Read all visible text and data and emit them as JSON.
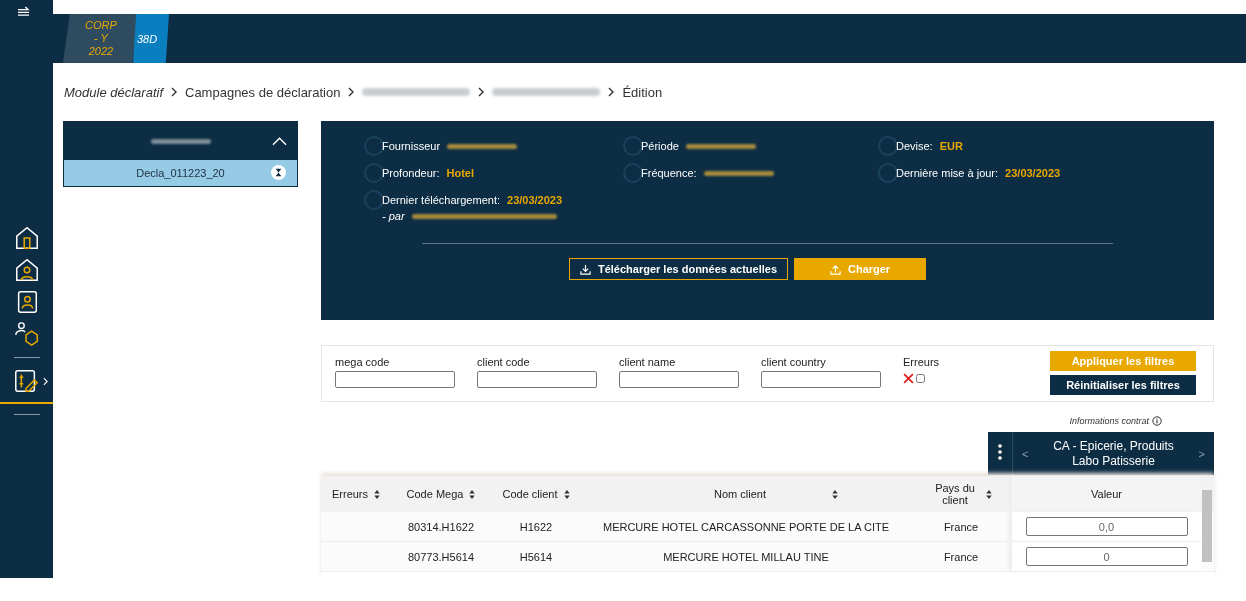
{
  "header": {
    "tabs": [
      {
        "label": "CORP - Y 2022",
        "selected": false
      },
      {
        "label": "38D",
        "selected": true
      }
    ]
  },
  "breadcrumb": [
    {
      "label": "Module déclaratif",
      "kind": "root"
    },
    {
      "label": "Campagnes de déclaration",
      "kind": "link"
    },
    {
      "kind": "blurred"
    },
    {
      "kind": "blurred"
    },
    {
      "label": "Édition",
      "kind": "link"
    }
  ],
  "declaration_panel": {
    "expanded": true,
    "items": [
      {
        "label": "Decla_011223_20",
        "selected": true
      }
    ]
  },
  "info": {
    "fields": [
      {
        "label": "Fournisseur",
        "kind": "blurred"
      },
      {
        "label": "Période",
        "kind": "blurred"
      },
      {
        "label": "Devise:",
        "value": "EUR",
        "kind": "value"
      },
      {
        "label": "Profondeur:",
        "value": "Hotel",
        "kind": "value"
      },
      {
        "label": "Fréquence:",
        "kind": "blurred"
      },
      {
        "label": "Dernière mise à jour:",
        "value": "23/03/2023",
        "kind": "value"
      },
      {
        "label": "Dernier téléchargement:",
        "value": "23/03/2023",
        "kind": "value",
        "by": "- par"
      }
    ],
    "buttons": [
      {
        "label": "Télécharger les données actuelles",
        "kind": "outline"
      },
      {
        "label": "Charger",
        "kind": "primary"
      }
    ]
  },
  "filters": {
    "fields": [
      {
        "label": "mega code"
      },
      {
        "label": "client code"
      },
      {
        "label": "client name"
      },
      {
        "label": "client country"
      }
    ],
    "errors": {
      "label": "Erreurs",
      "checked": false
    },
    "buttons": [
      {
        "label": "Appliquer les filtres",
        "kind": "primary"
      },
      {
        "label": "Réinitialiser les filtres",
        "kind": "dark"
      }
    ]
  },
  "contract_info": "Informations contrat",
  "contract_selector": {
    "prev": "<",
    "label": "CA - Epicerie, Produits Labo Patisserie",
    "next": ">"
  },
  "table": {
    "columns": [
      "Erreurs",
      "Code Mega",
      "Code client",
      "Nom client",
      "Pays du client"
    ],
    "value_column": "Valeur",
    "rows": [
      {
        "code_mega": "80314.H1622",
        "code_client": "H1622",
        "nom_client": "MERCURE HOTEL CARCASSONNE PORTE DE LA CITE",
        "pays": "France",
        "valeur": "0,0"
      },
      {
        "code_mega": "80773.H5614",
        "code_client": "H5614",
        "nom_client": "MERCURE HOTEL MILLAU TINE",
        "pays": "France",
        "valeur": "0"
      }
    ]
  }
}
